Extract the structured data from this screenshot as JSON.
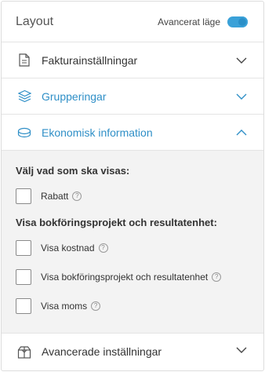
{
  "header": {
    "title": "Layout",
    "advanced_mode_label": "Avancerat läge",
    "advanced_mode_on": true
  },
  "sections": [
    {
      "label": "Fakturainställningar",
      "icon": "document-icon",
      "expanded": false
    },
    {
      "label": "Grupperingar",
      "icon": "layers-icon",
      "expanded": false
    },
    {
      "label": "Ekonomisk information",
      "icon": "coins-icon",
      "expanded": true
    }
  ],
  "economic": {
    "group1_title": "Välj vad som ska visas:",
    "rabatt": "Rabatt",
    "group2_title": "Visa bokföringsprojekt och resultatenhet:",
    "visa_kostnad": "Visa kostnad",
    "visa_bokforing": "Visa bokföringsprojekt och resultatenhet",
    "visa_moms": "Visa moms",
    "help_glyph": "?"
  },
  "advanced_settings": {
    "label": "Avancerade inställningar",
    "icon": "gift-box-icon"
  },
  "colors": {
    "accent": "#2f8fc7",
    "toggle": "#3aa1d8",
    "panel_bg": "#f3f3f3"
  }
}
